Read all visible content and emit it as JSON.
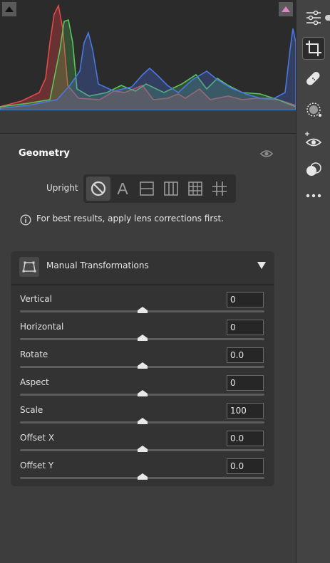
{
  "geometry": {
    "title": "Geometry",
    "upright_label": "Upright",
    "upright_options": [
      {
        "name": "off",
        "icon": "no-symbol-icon",
        "active": true
      },
      {
        "name": "auto",
        "icon": "letter-a-icon",
        "glyph": "A"
      },
      {
        "name": "level",
        "icon": "level-icon"
      },
      {
        "name": "vertical",
        "icon": "vertical-icon"
      },
      {
        "name": "full",
        "icon": "full-grid-icon"
      },
      {
        "name": "guided",
        "icon": "guided-crosshair-icon"
      }
    ],
    "info_text": "For best results, apply lens corrections first."
  },
  "manual": {
    "title": "Manual Transformations",
    "expanded": true,
    "sliders": [
      {
        "label": "Vertical",
        "value": "0",
        "position": 0.5
      },
      {
        "label": "Horizontal",
        "value": "0",
        "position": 0.5
      },
      {
        "label": "Rotate",
        "value": "0.0",
        "position": 0.5
      },
      {
        "label": "Aspect",
        "value": "0",
        "position": 0.5
      },
      {
        "label": "Scale",
        "value": "100",
        "position": 0.5
      },
      {
        "label": "Offset X",
        "value": "0.0",
        "position": 0.5
      },
      {
        "label": "Offset Y",
        "value": "0.0",
        "position": 0.5
      }
    ]
  },
  "toolbar": {
    "tools": [
      {
        "name": "edit",
        "icon": "sliders-icon"
      },
      {
        "name": "crop",
        "icon": "crop-icon",
        "active": true
      },
      {
        "name": "healing",
        "icon": "bandage-icon"
      },
      {
        "name": "masking",
        "icon": "mask-icon"
      },
      {
        "name": "red-eye",
        "icon": "red-eye-icon"
      },
      {
        "name": "presets",
        "icon": "presets-icon"
      },
      {
        "name": "more",
        "icon": "more-icon"
      }
    ]
  },
  "colors": {
    "panel_bg": "#3d3d3d",
    "histogram_bg": "#2b2b2b",
    "section_bg": "#333333",
    "highlight_clip": "#e084c4"
  }
}
